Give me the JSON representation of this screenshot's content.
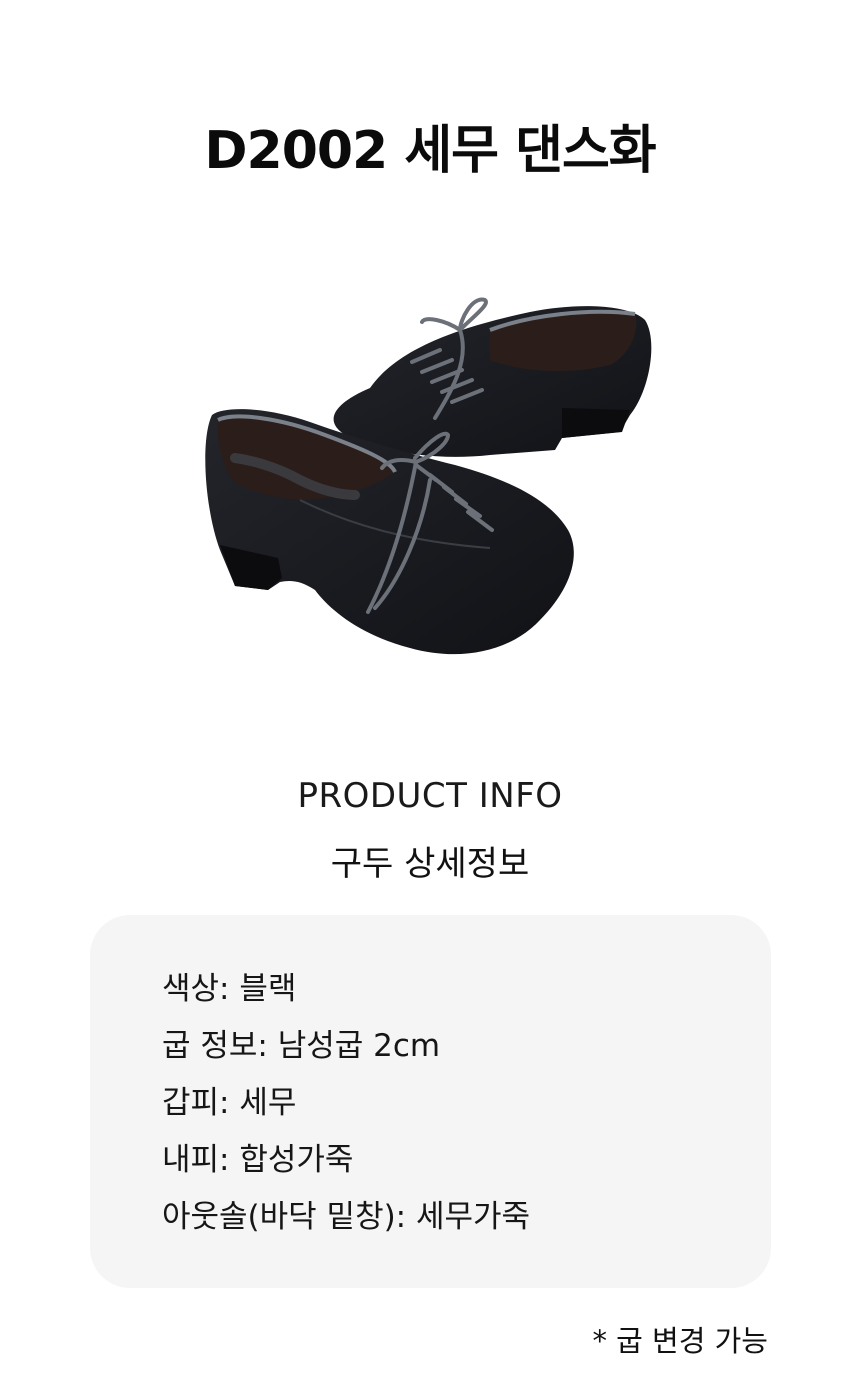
{
  "page": {
    "title": "D2002 세무 댄스화"
  },
  "product_image": {
    "icon": "black-suede-dance-shoes-image"
  },
  "section": {
    "label_en": "PRODUCT INFO",
    "label_ko": "구두 상세정보"
  },
  "info": {
    "rows": [
      "색상: 블랙",
      "굽 정보: 남성굽 2cm",
      "갑피: 세무",
      "내피: 합성가죽",
      "아웃솔(바닥 밑창): 세무가죽"
    ]
  },
  "footnote": "* 굽 변경 가능",
  "colors": {
    "background": "#ffffff",
    "card": "#f5f5f5",
    "shoe": "#17181c",
    "lace": "#6b7079"
  }
}
